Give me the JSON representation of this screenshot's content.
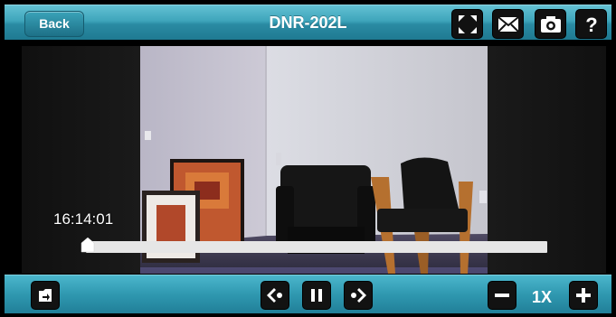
{
  "header": {
    "back_label": "Back",
    "title": "DNR-202L",
    "icons": [
      "fullscreen-icon",
      "email-icon",
      "camera-snapshot-icon",
      "help-icon"
    ]
  },
  "player": {
    "timestamp": "16:14:01",
    "progress": 0
  },
  "footer": {
    "speed_label": "1X",
    "icons": [
      "export-icon",
      "step-back-icon",
      "pause-icon",
      "step-forward-icon",
      "speed-decrease-icon",
      "speed-increase-icon"
    ]
  },
  "colors": {
    "bar_accent": "#3ea5bb",
    "button_bg": "#111111"
  }
}
